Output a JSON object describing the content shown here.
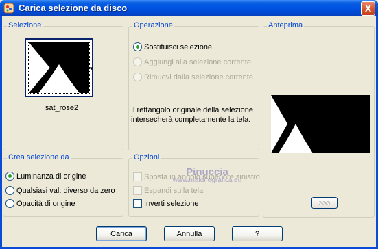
{
  "window": {
    "title": "Carica selezione da disco",
    "close_glyph": "X",
    "app_icon": "paint-shop-pro-icon"
  },
  "selezione": {
    "legend": "Selezione",
    "file_name": "sat_rose2",
    "dropdown_arrow": "▼"
  },
  "operazione": {
    "legend": "Operazione",
    "options": [
      {
        "label": "Sostituisci selezione",
        "checked": true,
        "enabled": true
      },
      {
        "label": "Aggiungi alla selezione corrente",
        "checked": false,
        "enabled": false
      },
      {
        "label": "Rimuovi dalla selezione corrente",
        "checked": false,
        "enabled": false
      }
    ],
    "info_line1": "Il rettangolo originale della selezione",
    "info_line2": "intersecherà completamente la tela."
  },
  "anteprima": {
    "legend": "Anteprima"
  },
  "crea": {
    "legend": "Crea selezione da",
    "options": [
      {
        "label": "Luminanza di origine",
        "checked": true
      },
      {
        "label": "Qualsiasi val. diverso da zero",
        "checked": false
      },
      {
        "label": "Opacità di origine",
        "checked": false
      }
    ]
  },
  "opzioni": {
    "legend": "Opzioni",
    "options": [
      {
        "label": "Sposta in angolo superiore sinistro",
        "checked": false,
        "enabled": false
      },
      {
        "label": "Espandi sulla tela",
        "checked": false,
        "enabled": false
      },
      {
        "label": "Inverti selezione",
        "checked": false,
        "enabled": true
      }
    ]
  },
  "watermark": {
    "name": "Pinuccia",
    "url": "www.maidiregrafica.eu"
  },
  "buttons": {
    "load": "Carica",
    "cancel": "Annulla",
    "help": "?"
  }
}
